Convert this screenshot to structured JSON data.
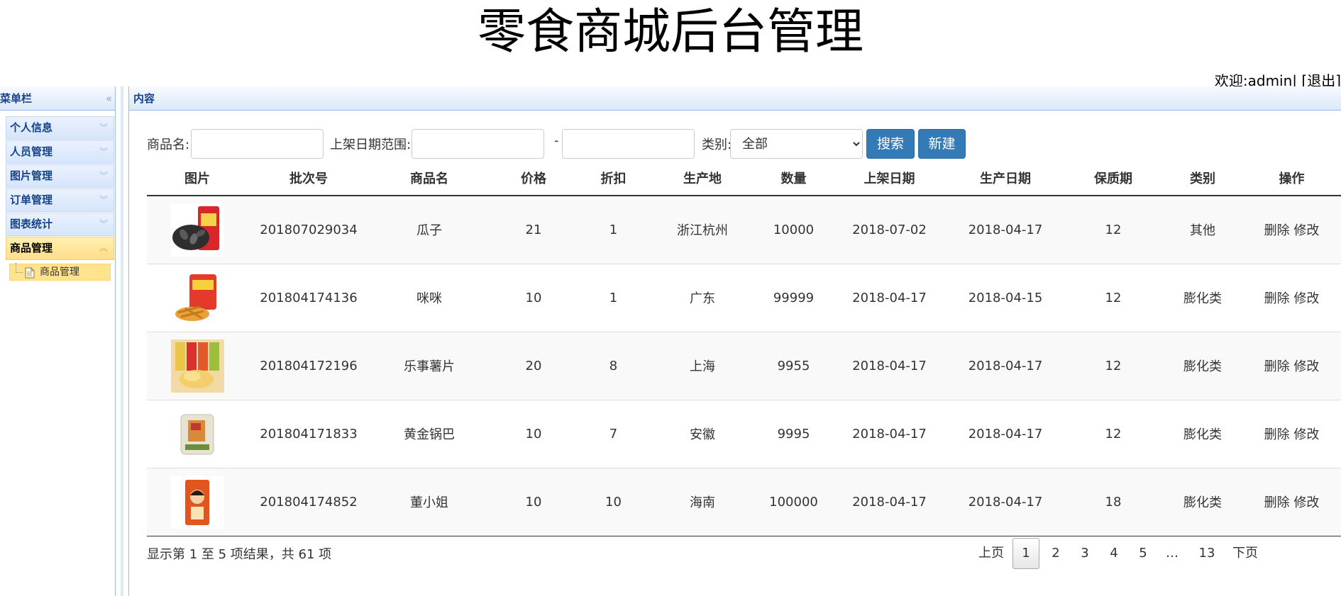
{
  "header": {
    "title": "零食商城后台管理",
    "welcome": "欢迎:admin| [退出]"
  },
  "menu": {
    "title": "菜单栏",
    "items": [
      {
        "label": "个人信息"
      },
      {
        "label": "人员管理"
      },
      {
        "label": "图片管理"
      },
      {
        "label": "订单管理"
      },
      {
        "label": "图表统计"
      },
      {
        "label": "商品管理",
        "active": true
      }
    ],
    "sub_items": [
      {
        "label": "商品管理"
      }
    ]
  },
  "content": {
    "title": "内容"
  },
  "search": {
    "name_label": "商品名:",
    "name_value": "",
    "date_label": "上架日期范围:",
    "date_from": "",
    "date_sep": "-",
    "date_to": "",
    "category_label": "类别:",
    "category_selected": "全部",
    "search_button": "搜索",
    "new_button": "新建"
  },
  "table": {
    "columns": [
      "图片",
      "批次号",
      "商品名",
      "价格",
      "折扣",
      "生产地",
      "数量",
      "上架日期",
      "生产日期",
      "保质期",
      "类别",
      "操作"
    ],
    "rows": [
      {
        "batch": "201807029034",
        "name": "瓜子",
        "price": "21",
        "discount": "1",
        "origin": "浙江杭州",
        "qty": "10000",
        "listed": "2018-07-02",
        "produced": "2018-04-17",
        "shelf_life": "12",
        "category": "其他",
        "delete": "删除",
        "edit": "修改"
      },
      {
        "batch": "201804174136",
        "name": "咪咪",
        "price": "10",
        "discount": "1",
        "origin": "广东",
        "qty": "99999",
        "listed": "2018-04-17",
        "produced": "2018-04-15",
        "shelf_life": "12",
        "category": "膨化类",
        "delete": "删除",
        "edit": "修改"
      },
      {
        "batch": "201804172196",
        "name": "乐事薯片",
        "price": "20",
        "discount": "8",
        "origin": "上海",
        "qty": "9955",
        "listed": "2018-04-17",
        "produced": "2018-04-17",
        "shelf_life": "12",
        "category": "膨化类",
        "delete": "删除",
        "edit": "修改"
      },
      {
        "batch": "201804171833",
        "name": "黄金锅巴",
        "price": "10",
        "discount": "7",
        "origin": "安徽",
        "qty": "9995",
        "listed": "2018-04-17",
        "produced": "2018-04-17",
        "shelf_life": "12",
        "category": "膨化类",
        "delete": "删除",
        "edit": "修改"
      },
      {
        "batch": "201804174852",
        "name": "董小姐",
        "price": "10",
        "discount": "10",
        "origin": "海南",
        "qty": "100000",
        "listed": "2018-04-17",
        "produced": "2018-04-17",
        "shelf_life": "18",
        "category": "膨化类",
        "delete": "删除",
        "edit": "修改"
      }
    ]
  },
  "footer": {
    "info": "显示第 1 至 5 项结果，共 61 项"
  },
  "pagination": {
    "prev": "上页",
    "pages": [
      "1",
      "2",
      "3",
      "4",
      "5",
      "…",
      "13"
    ],
    "current": "1",
    "next": "下页"
  }
}
